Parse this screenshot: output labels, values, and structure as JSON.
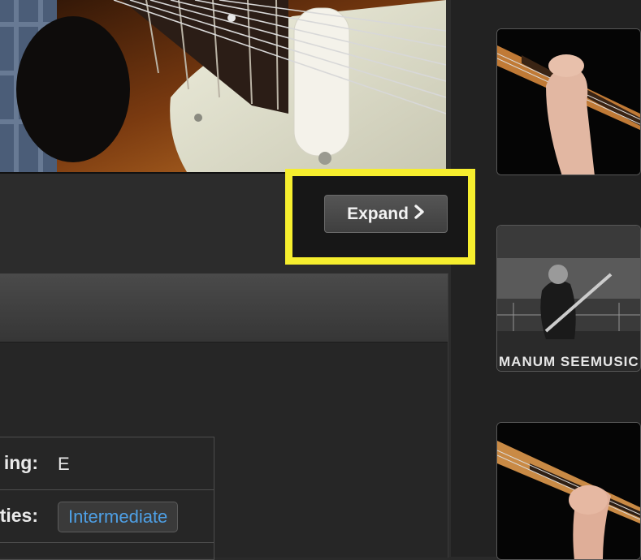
{
  "video": {
    "main_scene": "electric guitar body close-up"
  },
  "expand_button": {
    "label": "Expand",
    "icon": "chevron-right-icon",
    "highlight_color": "#f6ee2e"
  },
  "info": {
    "rows": [
      {
        "label": "ing:",
        "value": "E"
      },
      {
        "label": "ties:",
        "tag": "Intermediate"
      }
    ]
  },
  "thumbnails": [
    {
      "scene": "hand on guitar neck"
    },
    {
      "scene": "black and white live performance",
      "caption": "MANUM SEEMUSIC"
    },
    {
      "scene": "hand fretting guitar neck"
    }
  ],
  "colors": {
    "background": "#2a2a2a",
    "accent_link": "#4ea0e6"
  }
}
